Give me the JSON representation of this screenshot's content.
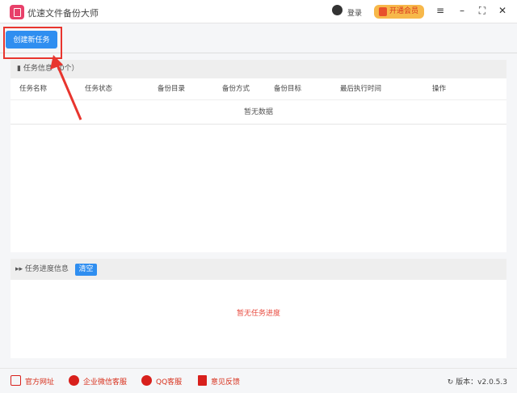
{
  "app": {
    "title": "优速文件备份大师",
    "login": "登录",
    "vip": "开通会员"
  },
  "toolbar": {
    "create_label": "创建新任务"
  },
  "tasks": {
    "header": "任务信息（0个）",
    "columns": [
      "任务名称",
      "任务状态",
      "备份目录",
      "备份方式",
      "备份目标",
      "最后执行时间",
      "操作"
    ],
    "empty": "暂无数据"
  },
  "progress": {
    "header": "任务进度信息",
    "clear": "清空",
    "empty": "暂无任务进度"
  },
  "footer": {
    "links": [
      "官方网址",
      "企业微信客服",
      "QQ客服",
      "意见反馈"
    ],
    "version": "版本：v2.0.5.3"
  }
}
